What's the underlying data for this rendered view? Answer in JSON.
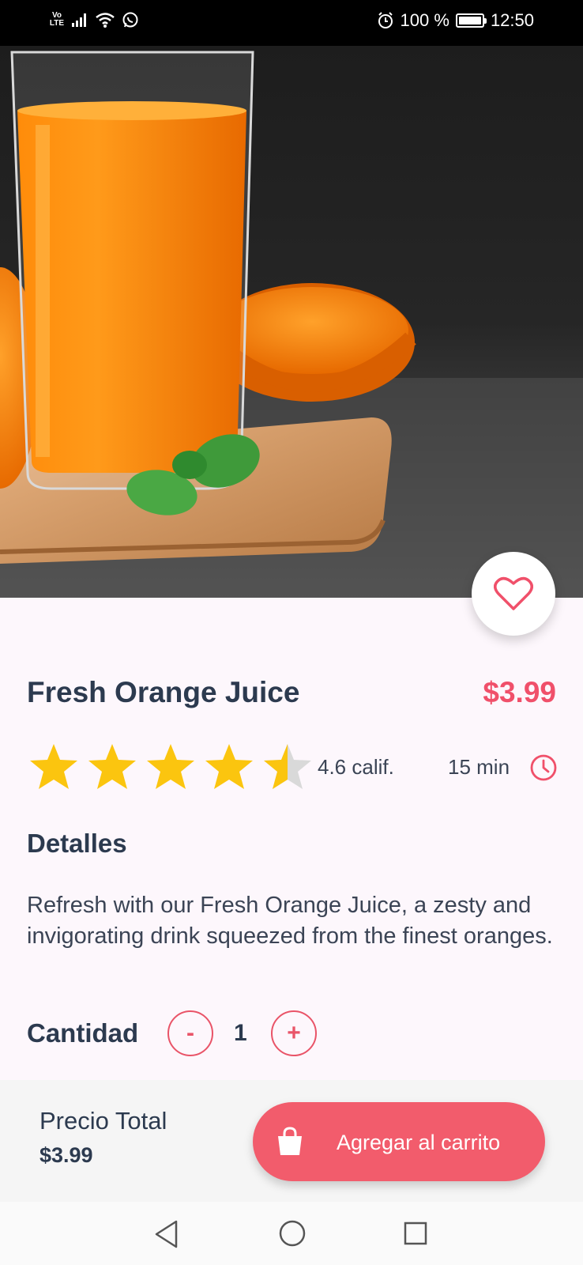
{
  "status_bar": {
    "network": "Vo LTE",
    "battery": "100 %",
    "time": "12:50"
  },
  "product": {
    "name": "Fresh Orange Juice",
    "price": "$3.99",
    "rating": 4.6,
    "rating_label": "4.6 calif.",
    "time": "15 min",
    "details_title": "Detalles",
    "description": "Refresh with our Fresh Orange Juice, a zesty and invigorating drink squeezed from the finest oranges."
  },
  "quantity": {
    "label": "Cantidad",
    "minus": "-",
    "value": "1",
    "plus": "+"
  },
  "footer": {
    "total_label": "Precio Total",
    "total_value": "$3.99",
    "cart_button": "Agregar al carrito"
  },
  "colors": {
    "accent": "#f25c6c",
    "text_dark": "#2c3a4f",
    "star": "#fbc50f"
  },
  "icons": {
    "favorite": "heart-icon",
    "time": "clock-icon",
    "cart": "shopping-bag-icon"
  }
}
